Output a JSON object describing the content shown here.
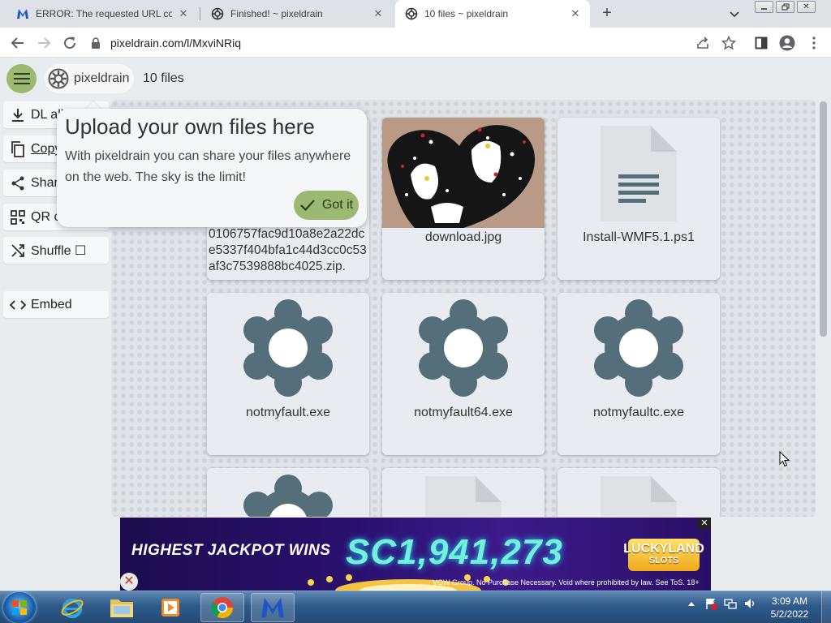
{
  "browser": {
    "tabs": [
      {
        "title": "ERROR: The requested URL could",
        "favicon": "malwarebytes-logo"
      },
      {
        "title": "Finished! ~ pixeldrain",
        "favicon": "pixeldrain-gear"
      },
      {
        "title": "10 files ~ pixeldrain",
        "favicon": "pixeldrain-gear",
        "active": true
      }
    ],
    "new_tab_label": "+",
    "url": "pixeldrain.com/l/MxviNRiq",
    "window_buttons": [
      "minimize",
      "maximize",
      "close"
    ]
  },
  "header": {
    "brand": "pixeldrain",
    "file_count": "10 files"
  },
  "sidebar": {
    "items": [
      {
        "label": "DL all",
        "icon": "download-icon"
      },
      {
        "label": "Copy",
        "icon": "copy-icon"
      },
      {
        "label": "Share",
        "icon": "share-icon"
      },
      {
        "label": "QR c",
        "icon": "qr-icon"
      },
      {
        "label": "Shuffle ☐",
        "icon": "shuffle-icon"
      },
      {
        "label": "Embed",
        "icon": "embed-icon"
      }
    ]
  },
  "tooltip": {
    "title": "Upload your own files here",
    "body": "With pixeldrain you can share your files anywhere on the web. The sky is the limit!",
    "button": "Got it"
  },
  "files": [
    {
      "name": "0106757fac9d10a8e2a22dce5337f404bfa1c44d3cc0c53af3c7539888bc4025.zip.",
      "type": "zip"
    },
    {
      "name": "download.jpg",
      "type": "image"
    },
    {
      "name": "Install-WMF5.1.ps1",
      "type": "document"
    },
    {
      "name": "notmyfault.exe",
      "type": "executable"
    },
    {
      "name": "notmyfault64.exe",
      "type": "executable"
    },
    {
      "name": "notmyfaultc.exe",
      "type": "executable"
    },
    {
      "name": "",
      "type": "executable"
    },
    {
      "name": "",
      "type": "document"
    },
    {
      "name": "",
      "type": "document"
    }
  ],
  "ad": {
    "headline": "HIGHEST JACKPOT WINS",
    "amount": "SC1,941,273",
    "logo_line1": "LUCKYLAND",
    "logo_line2": "SLOTS",
    "fine_print": "VGW Group. No Purchase Necessary. Void where prohibited by law. See ToS. 18+",
    "close": "✕"
  },
  "taskbar": {
    "time": "3:09 AM",
    "date": "5/2/2022",
    "apps": [
      "internet-explorer",
      "file-explorer",
      "media-player",
      "chrome",
      "malwarebytes"
    ]
  },
  "colors": {
    "accent_green": "#9bb970",
    "page_bg": "#e9ecef",
    "card_bg": "#e8ecf0",
    "gear_color": "#546e7a"
  }
}
